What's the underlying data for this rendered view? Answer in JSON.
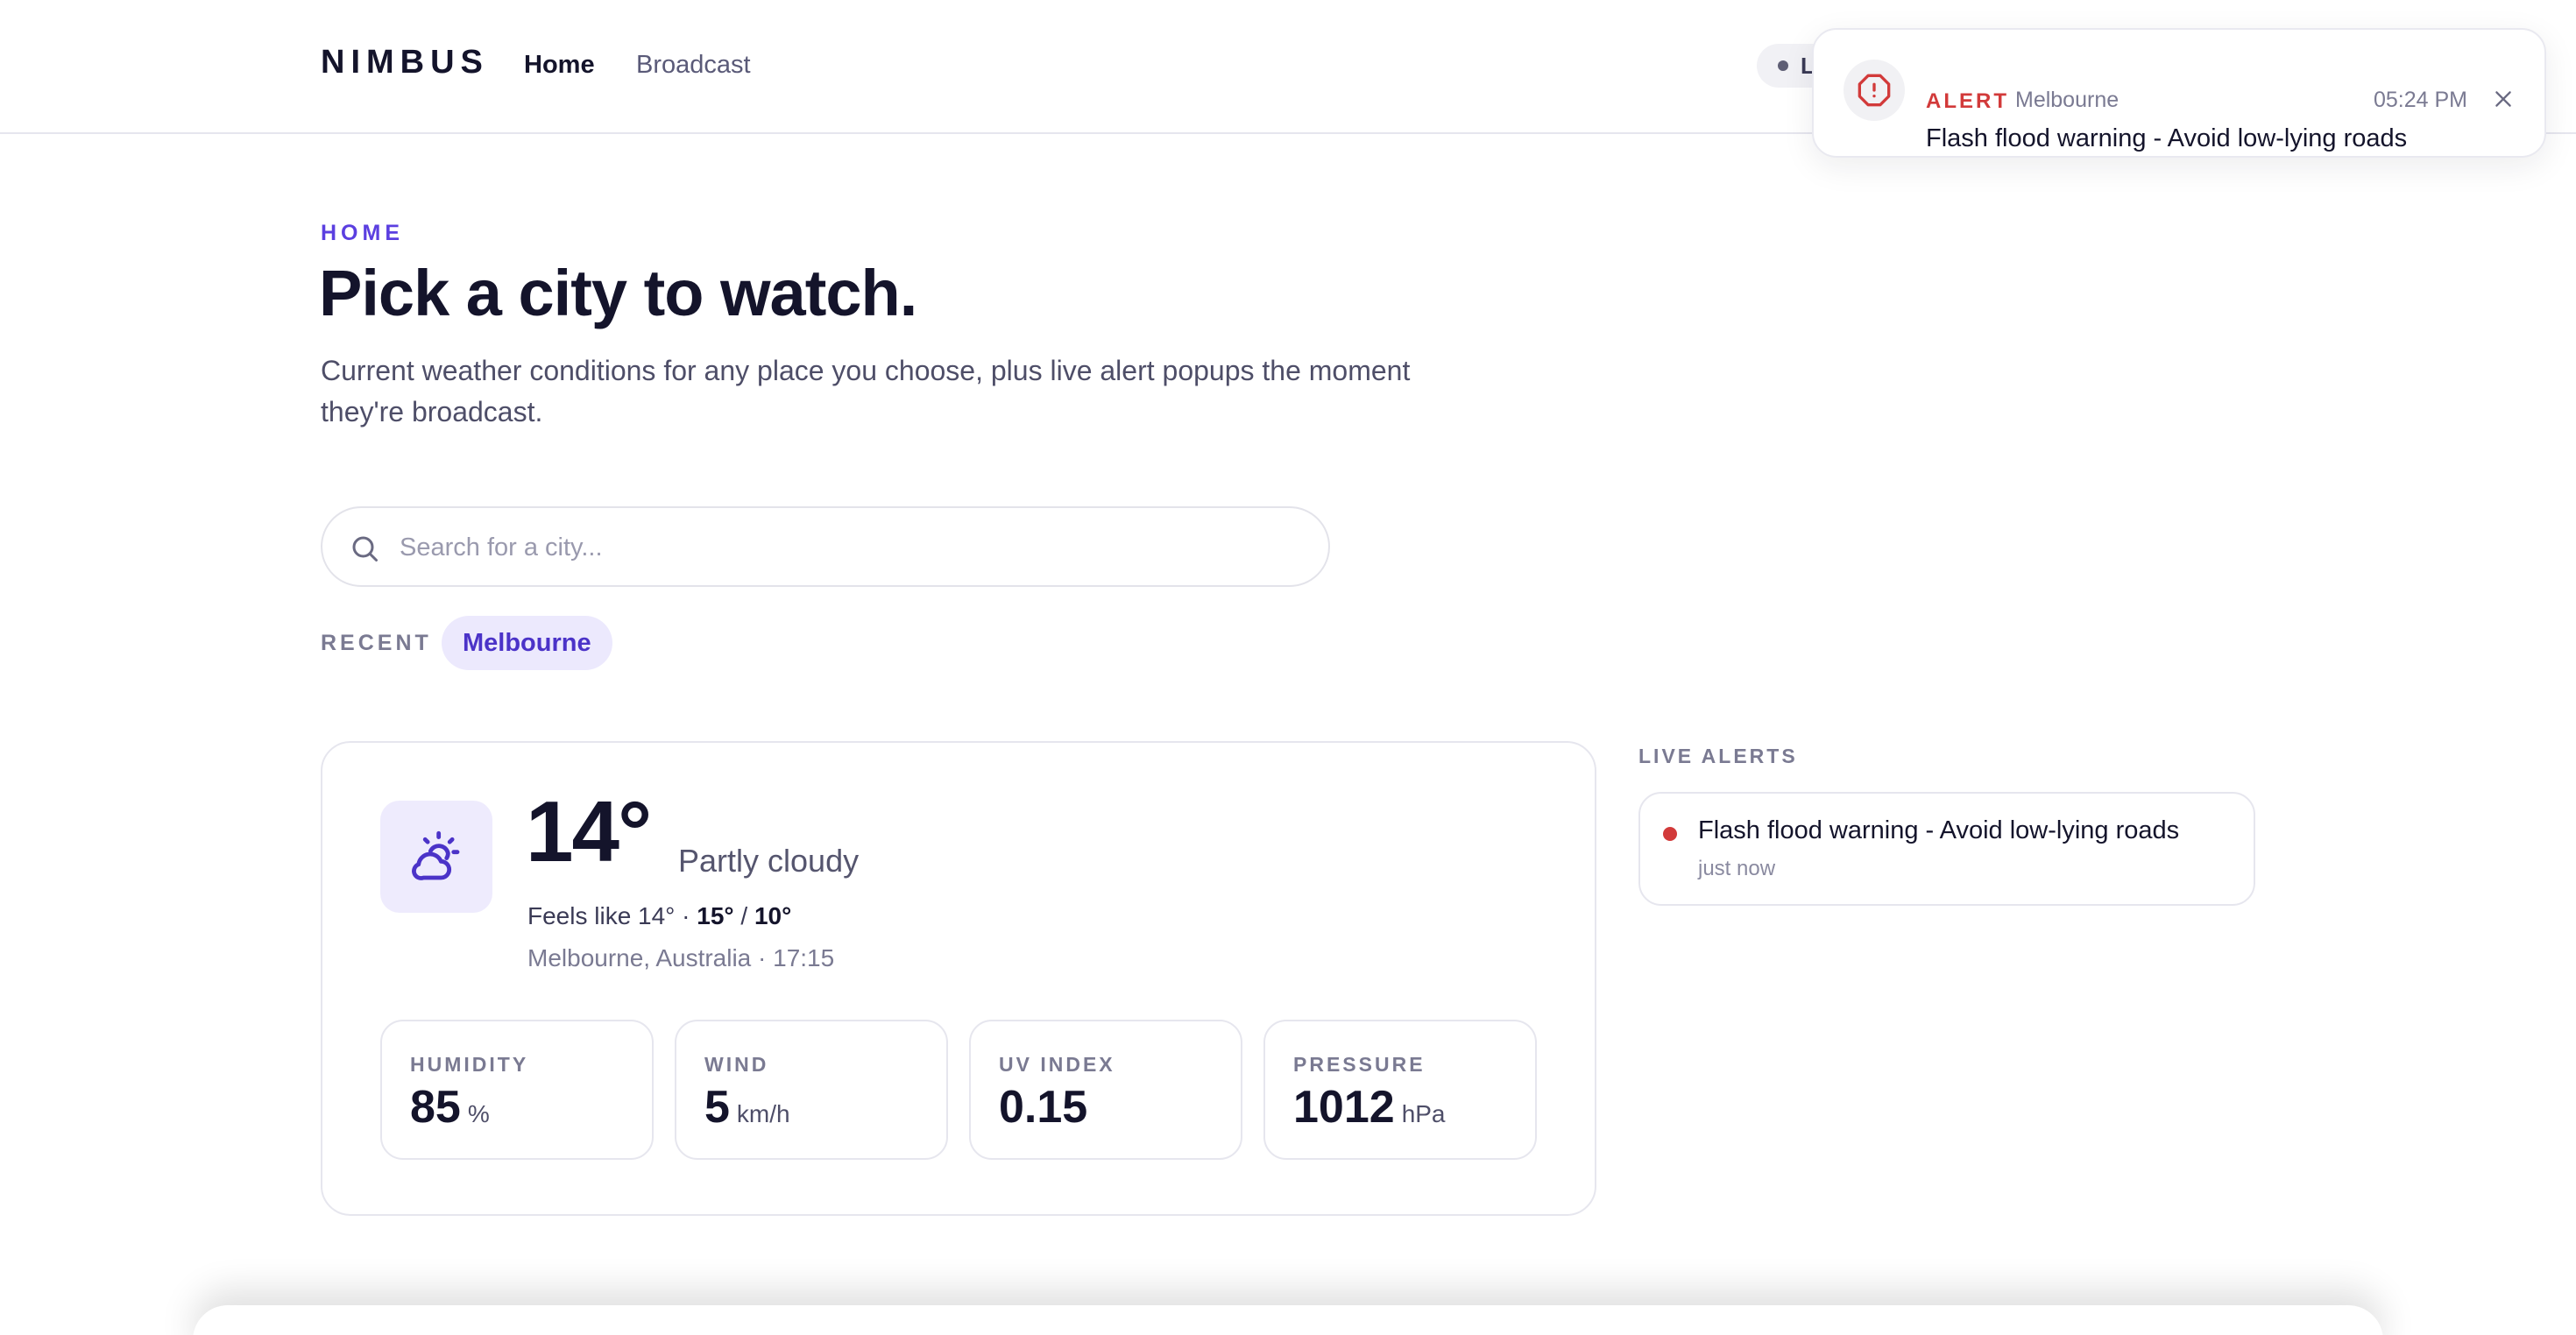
{
  "header": {
    "brand": "NIMBUS",
    "nav": {
      "home": "Home",
      "broadcast": "Broadcast"
    },
    "live_pill_label": "L"
  },
  "toast": {
    "tag": "ALERT",
    "city": "Melbourne",
    "time": "05:24 PM",
    "message": "Flash flood warning - Avoid low-lying roads",
    "icon": "alert-octagon-icon",
    "close_icon": "close-icon"
  },
  "hero": {
    "eyebrow": "HOME",
    "title": "Pick a city to watch.",
    "subtitle": "Current weather conditions for any place you choose, plus live alert popups the moment they're broadcast."
  },
  "search": {
    "placeholder": "Search for a city...",
    "value": "",
    "icon": "search-icon"
  },
  "recent": {
    "label": "RECENT",
    "items": [
      "Melbourne"
    ]
  },
  "weather": {
    "icon": "partly-cloudy-icon",
    "temperature": "14°",
    "condition": "Partly cloudy",
    "feels_like": "Feels like 14° · ",
    "high": "15°",
    "separator": " / ",
    "low": "10°",
    "location_time": "Melbourne, Australia · 17:15",
    "stats": [
      {
        "label": "HUMIDITY",
        "value": "85",
        "unit": "%"
      },
      {
        "label": "WIND",
        "value": "5",
        "unit": "km/h"
      },
      {
        "label": "UV INDEX",
        "value": "0.15",
        "unit": ""
      },
      {
        "label": "PRESSURE",
        "value": "1012",
        "unit": "hPa"
      }
    ]
  },
  "live_alerts": {
    "label": "LIVE ALERTS",
    "items": [
      {
        "text": "Flash flood warning - Avoid low-lying roads",
        "time": "just now"
      }
    ]
  },
  "colors": {
    "accent": "#5b3fe0",
    "alert": "#d23a3a",
    "text": "#14142b",
    "muted": "#7a7a92"
  }
}
